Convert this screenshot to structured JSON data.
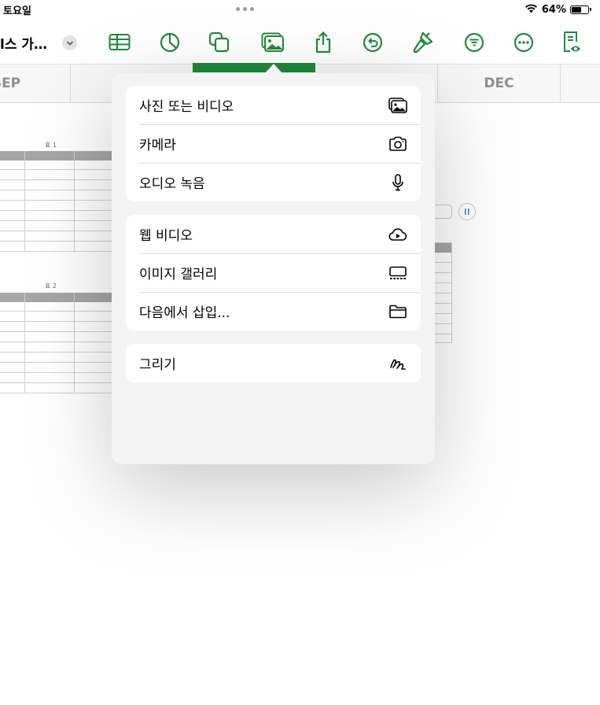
{
  "status_bar": {
    "day": "토요일",
    "battery": "64%",
    "battery_level": 0.64
  },
  "toolbar": {
    "doc_title": "l스 가…",
    "icons": [
      "table-icon",
      "chart-icon",
      "shapes-icon",
      "media-icon",
      "share-icon",
      "undo-icon",
      "format-brush-icon",
      "filter-icon",
      "more-icon",
      "reader-view-icon"
    ],
    "accent_color": "#1e8a3c"
  },
  "months": [
    "SEP",
    "DEC"
  ],
  "tables": {
    "table1_caption": "표 1",
    "table2_caption": "표 2"
  },
  "media_menu": {
    "groups": [
      {
        "items": [
          {
            "label": "사진 또는 비디오",
            "icon": "photo-library-icon"
          },
          {
            "label": "카메라",
            "icon": "camera-icon"
          },
          {
            "label": "오디오 녹음",
            "icon": "microphone-icon"
          }
        ]
      },
      {
        "items": [
          {
            "label": "웹 비디오",
            "icon": "cloud-play-icon"
          },
          {
            "label": "이미지 갤러리",
            "icon": "image-gallery-icon"
          },
          {
            "label": "다음에서 삽입...",
            "icon": "folder-icon"
          }
        ]
      },
      {
        "items": [
          {
            "label": "그리기",
            "icon": "drawing-icon"
          }
        ]
      }
    ]
  }
}
